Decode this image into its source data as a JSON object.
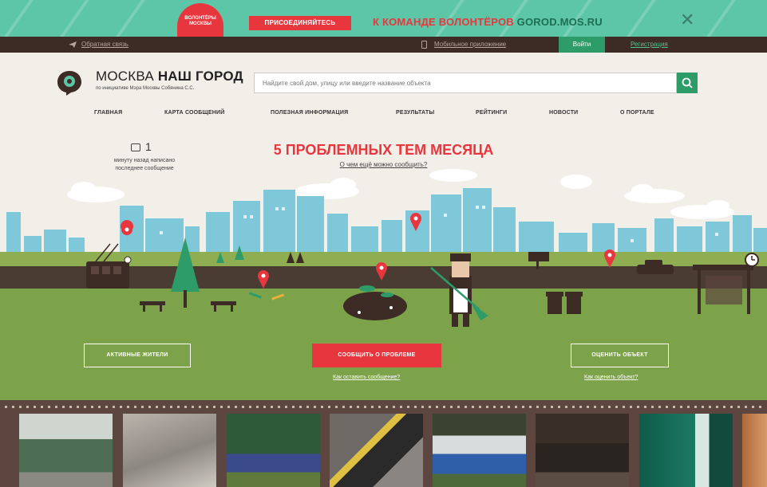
{
  "promo": {
    "logo_text": "ВОЛОНТЁРЫ МОСКВЫ",
    "join_label": "ПРИСОЕДИНЯЙТЕСЬ",
    "headline": "К КОМАНДЕ ВОЛОНТЁРОВ",
    "domain": "GOROD.MOS.RU",
    "close": "✕"
  },
  "topbar": {
    "feedback": "Обратная связь",
    "mobile_app": "Мобильное приложение",
    "login": "Войти",
    "register": "Регистрация"
  },
  "header": {
    "brand_light": "МОСКВА ",
    "brand_bold": "НАШ ГОРОД",
    "brand_sub": "по инициативе Мэра Москвы Собянина С.С.",
    "search_placeholder": "Найдите свой дом, улицу или введите название объекта"
  },
  "nav": [
    "ГЛАВНАЯ",
    "КАРТА СООБЩЕНИЙ",
    "ПОЛЕЗНАЯ ИНФОРМАЦИЯ",
    "РЕЗУЛЬТАТЫ",
    "РЕЙТИНГИ",
    "НОВОСТИ",
    "О ПОРТАЛЕ"
  ],
  "hero": {
    "counter": "1",
    "counter_text": "минуту назад написано последнее сообщение",
    "title": "5 ПРОБЛЕМНЫХ ТЕМ МЕСЯЦА",
    "subtitle": "О чем ещё можно сообщить?",
    "btn_active": "АКТИВНЫЕ ЖИТЕЛИ",
    "btn_report": "СООБЩИТЬ О ПРОБЛЕМЕ",
    "btn_rate": "ОЦЕНИТЬ ОБЪЕКТ",
    "link_report": "Как оставить сообщение?",
    "link_rate": "Как оценить объект?"
  },
  "colors": {
    "accent_red": "#e8363f",
    "mint": "#5cc6a6",
    "brand_green": "#2e9c68",
    "dark_brown": "#3d2b26",
    "grass": "#7da34a"
  }
}
